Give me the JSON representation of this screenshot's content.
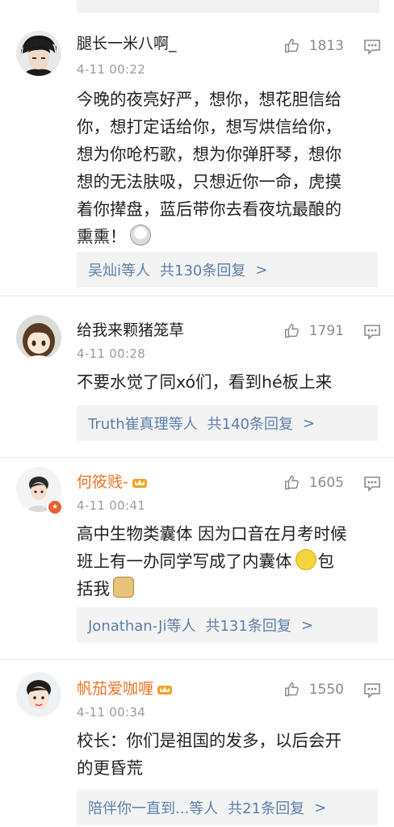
{
  "comments": [
    {
      "username": "腿长一米八啊_",
      "time": "4-11 00:22",
      "likes": "1813",
      "text_lines": [
        "今晚的夜亮好严，想你，想花胆信给",
        "你，想打定话给你，想写烘信给你，",
        "想为你呛朽歌，想为你弹肝琴，想你",
        "想的无法肤吸，只想近你一命，虎摸",
        "着你撵盘，蓝后带你去看夜坑最酿的",
        "熏熏！"
      ],
      "replies_by": "吴灿i等人",
      "replies_count": "共130条回复",
      "emoji": "cry-laugh-emoji"
    },
    {
      "username": "给我来颗猪笼草",
      "time": "4-11 00:28",
      "likes": "1791",
      "text_lines": [
        "不要水觉了同xó们，看到hé板上来"
      ],
      "replies_by": "Truth崔真理等人",
      "replies_count": "共140条回复"
    },
    {
      "username": "何筱贱-",
      "time": "4-11 00:41",
      "likes": "1605",
      "text_lines": [
        "高中生物类囊体 因为口音在月考时候",
        "班上有一办同学写成了内囊体",
        "括我"
      ],
      "replies_by": "Jonathan-Ji等人",
      "replies_count": "共131条回复"
    },
    {
      "username": "帆茄爱咖喱",
      "time": "4-11 00:34",
      "likes": "1550",
      "text_lines": [
        "校长：你们是祖国的发多，以后会开",
        "的更昏荒"
      ],
      "replies_by": "陪伴你一直到...等人",
      "replies_count": "共21条回复"
    }
  ],
  "inline_text": {
    "bao": "包"
  },
  "chevron": ">",
  "colors": {
    "link": "#5d7faa",
    "vip_name": "#eb7329",
    "meta": "#9b9b9b"
  }
}
